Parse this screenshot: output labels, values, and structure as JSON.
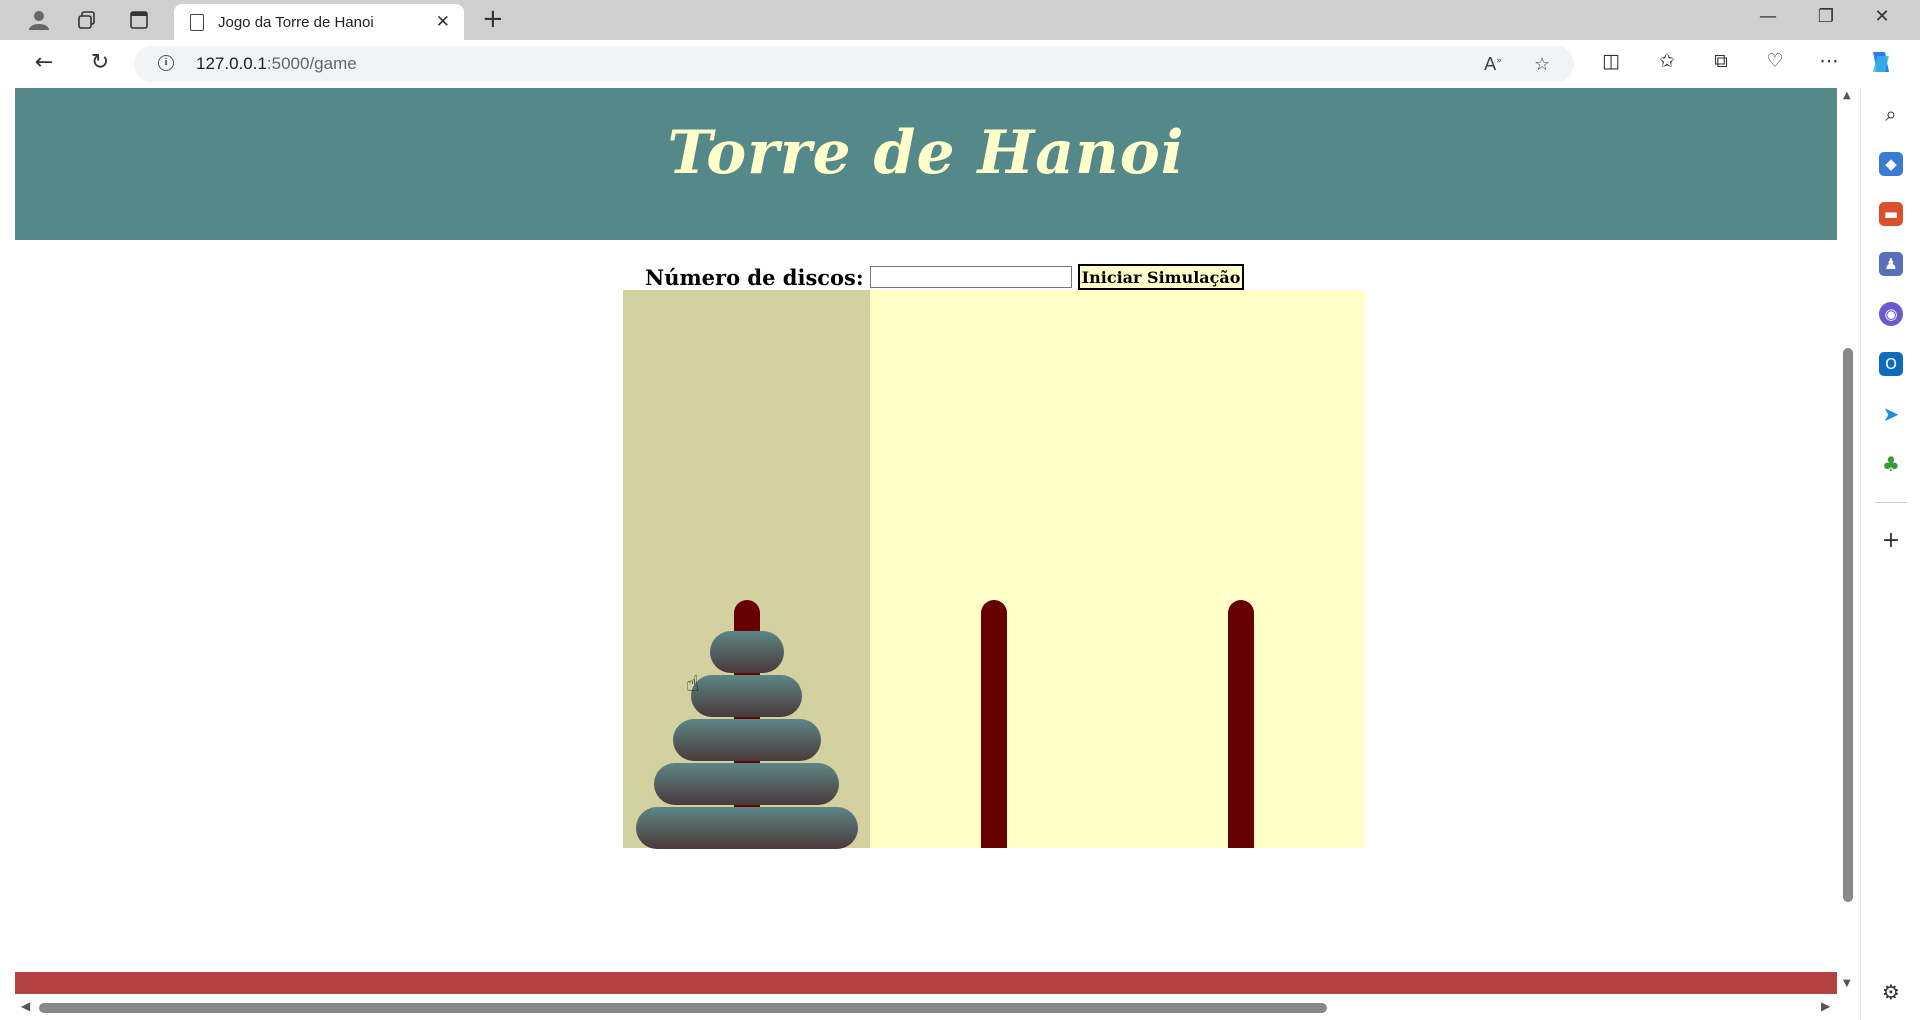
{
  "browser": {
    "tab_title": "Jogo da Torre de Hanoi",
    "url_host": "127.0.0.1",
    "url_path": ":5000/game",
    "icons": {
      "profile": "profile-icon",
      "workspaces": "workspaces-icon",
      "tab_actions": "tab-actions-icon",
      "page": "page-icon",
      "close": "close-icon",
      "new_tab": "plus-icon",
      "back": "back-arrow-icon",
      "refresh": "refresh-icon",
      "info": "info-icon",
      "read_aloud": "read-aloud-icon",
      "favorite": "star-icon",
      "split": "split-screen-icon",
      "favorites": "favorites-icon",
      "collections": "collections-icon",
      "extensions": "extensions-icon",
      "more": "more-icon",
      "copilot": "copilot-icon"
    }
  },
  "sidebar": {
    "items": [
      "search-icon",
      "shopping-icon",
      "tools-icon",
      "games-icon",
      "microsoft365-icon",
      "outlook-icon",
      "telegram-icon",
      "tree-icon",
      "add-icon",
      "settings-icon"
    ]
  },
  "page": {
    "title": "Torre de Hanoi",
    "controls": {
      "label": "Número de discos:",
      "input_value": "",
      "button_label": "Iniciar Simulação"
    }
  },
  "game": {
    "pegs": 3,
    "active_peg": 0,
    "disks_on_peg": [
      [
        5,
        4,
        3,
        2,
        1
      ],
      [],
      []
    ],
    "colors": {
      "board": "#ffffc7",
      "active_column": "#d3d19f",
      "peg": "#660000",
      "header": "#558888",
      "footer": "#b34141",
      "title": "#ffffcc"
    }
  }
}
